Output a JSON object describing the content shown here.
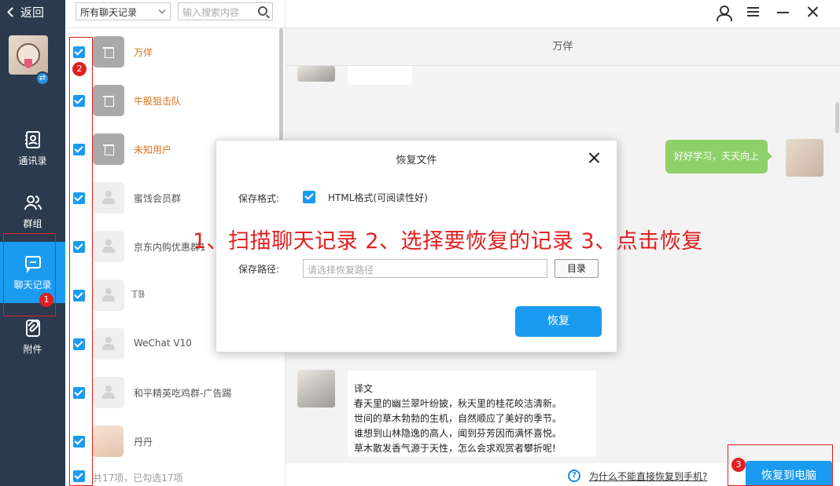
{
  "nav": {
    "back_label": "返回",
    "items": [
      {
        "label": "通讯录",
        "icon": "contacts-icon"
      },
      {
        "label": "群组",
        "icon": "group-icon"
      },
      {
        "label": "聊天记录",
        "icon": "chat-record-icon"
      },
      {
        "label": "附件",
        "icon": "attachment-icon"
      }
    ],
    "active_index": 2,
    "active_color": "#1a9bf0"
  },
  "toolbar": {
    "filter_selected": "所有聊天记录",
    "search_placeholder": "输入搜索内容"
  },
  "contacts": [
    {
      "name": "万佯",
      "deleted": true,
      "checked": true,
      "avatar": "deleted"
    },
    {
      "name": "牛股狙击队",
      "deleted": true,
      "checked": true,
      "avatar": "deleted"
    },
    {
      "name": "未知用户",
      "deleted": true,
      "checked": true,
      "avatar": "deleted"
    },
    {
      "name": "蜜饯会员群",
      "deleted": false,
      "checked": true,
      "avatar": "placeholder"
    },
    {
      "name": "京东内购优惠群1",
      "deleted": false,
      "checked": true,
      "avatar": "placeholder"
    },
    {
      "name": "𝕋𝔹",
      "deleted": false,
      "checked": true,
      "avatar": "placeholder"
    },
    {
      "name": "WeChat V10",
      "deleted": false,
      "checked": true,
      "avatar": "placeholder"
    },
    {
      "name": "和平精英吃鸡群-广告踢",
      "deleted": false,
      "checked": true,
      "avatar": "placeholder"
    },
    {
      "name": "丹丹",
      "deleted": false,
      "checked": true,
      "avatar": "photo"
    }
  ],
  "list_footer": {
    "count_text": "共17项，已勾选17项"
  },
  "chat": {
    "title": "万佯",
    "outgoing_message": "好好学习，天天向上",
    "incoming_message": {
      "heading": "译文",
      "lines": [
        "春天里的幽兰翠叶纷披，秋天里的桂花皎洁清新。",
        "世间的草木勃勃的生机，自然顺应了美好的季节。",
        "谁想到山林隐逸的高人，闻到芬芳因而满怀喜悦。",
        "草木散发香气源于天性，怎么会求观赏者攀折呢!"
      ]
    }
  },
  "bottom": {
    "help_text": "为什么不能直接恢复到手机?",
    "export_label": "恢复到电脑"
  },
  "modal": {
    "title": "恢复文件",
    "format_label": "保存格式:",
    "format_option": "HTML格式(可阅读性好)",
    "format_checked": true,
    "path_label": "保存路径:",
    "path_placeholder": "请选择恢复路径",
    "dir_button": "目录",
    "restore_button": "恢复"
  },
  "annotations": {
    "instruction": "1、扫描聊天记录 2、选择要恢复的记录 3、点击恢复",
    "badges": [
      "1",
      "2",
      "3"
    ],
    "color": "#e02020"
  }
}
